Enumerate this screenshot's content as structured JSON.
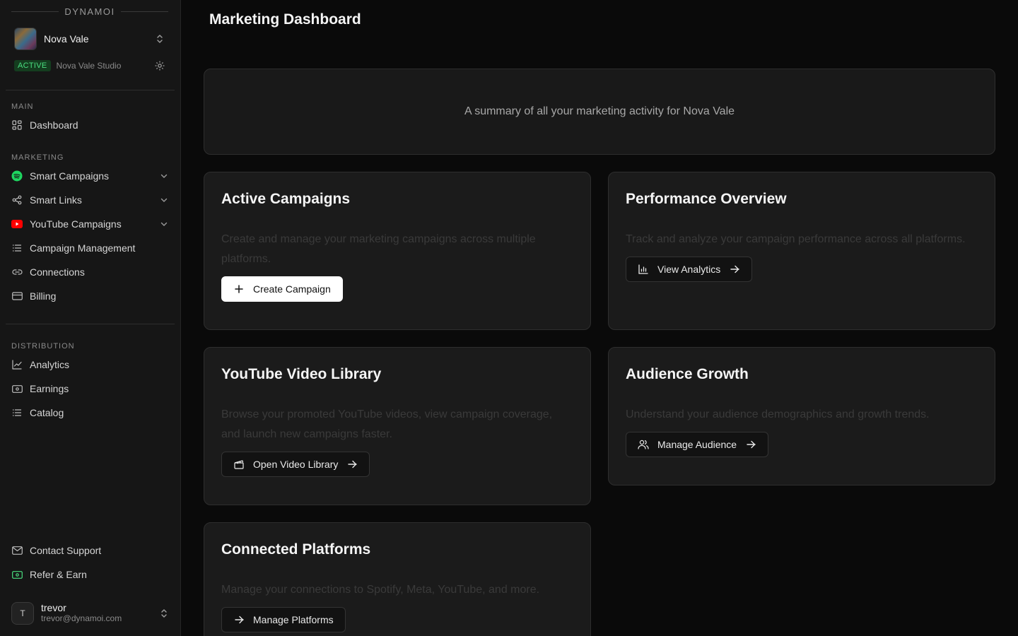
{
  "brand": "DYNAMOI",
  "artist": {
    "name": "Nova Vale",
    "status": "ACTIVE",
    "studio": "Nova Vale Studio"
  },
  "sidebar": {
    "main_label": "MAIN",
    "dashboard": "Dashboard",
    "marketing_label": "MARKETING",
    "marketing": [
      {
        "label": "Smart Campaigns",
        "icon": "spotify-icon"
      },
      {
        "label": "Smart Links",
        "icon": "share-icon"
      },
      {
        "label": "YouTube Campaigns",
        "icon": "youtube-icon"
      },
      {
        "label": "Campaign Management",
        "icon": "list-icon"
      },
      {
        "label": "Connections",
        "icon": "link-icon"
      },
      {
        "label": "Billing",
        "icon": "credit-card-icon"
      }
    ],
    "distribution_label": "DISTRIBUTION",
    "distribution": [
      {
        "label": "Analytics",
        "icon": "line-chart-icon"
      },
      {
        "label": "Earnings",
        "icon": "banknote-icon"
      },
      {
        "label": "Catalog",
        "icon": "list-icon"
      }
    ],
    "contact_support": "Contact Support",
    "refer_earn": "Refer & Earn"
  },
  "user": {
    "initial": "T",
    "name": "trevor",
    "email": "trevor@dynamoi.com"
  },
  "page": {
    "title": "Marketing Dashboard",
    "summary": "A summary of all your marketing activity for Nova Vale"
  },
  "cards": {
    "active_campaigns": {
      "title": "Active Campaigns",
      "desc": "Create and manage your marketing campaigns across multiple platforms.",
      "button": "Create Campaign"
    },
    "performance": {
      "title": "Performance Overview",
      "desc": "Track and analyze your campaign performance across all platforms.",
      "button": "View Analytics"
    },
    "video_library": {
      "title": "YouTube Video Library",
      "desc": "Browse your promoted YouTube videos, view campaign coverage, and launch new campaigns faster.",
      "button": "Open Video Library"
    },
    "audience": {
      "title": "Audience Growth",
      "desc": "Understand your audience demographics and growth trends.",
      "button": "Manage Audience"
    },
    "platforms": {
      "title": "Connected Platforms",
      "desc": "Manage your connections to Spotify, Meta, YouTube, and more.",
      "button": "Manage Platforms"
    }
  },
  "colors": {
    "accent_green": "#4ade80",
    "spotify": "#1ed760",
    "youtube": "#ff0000",
    "background": "#0a0a0a"
  }
}
